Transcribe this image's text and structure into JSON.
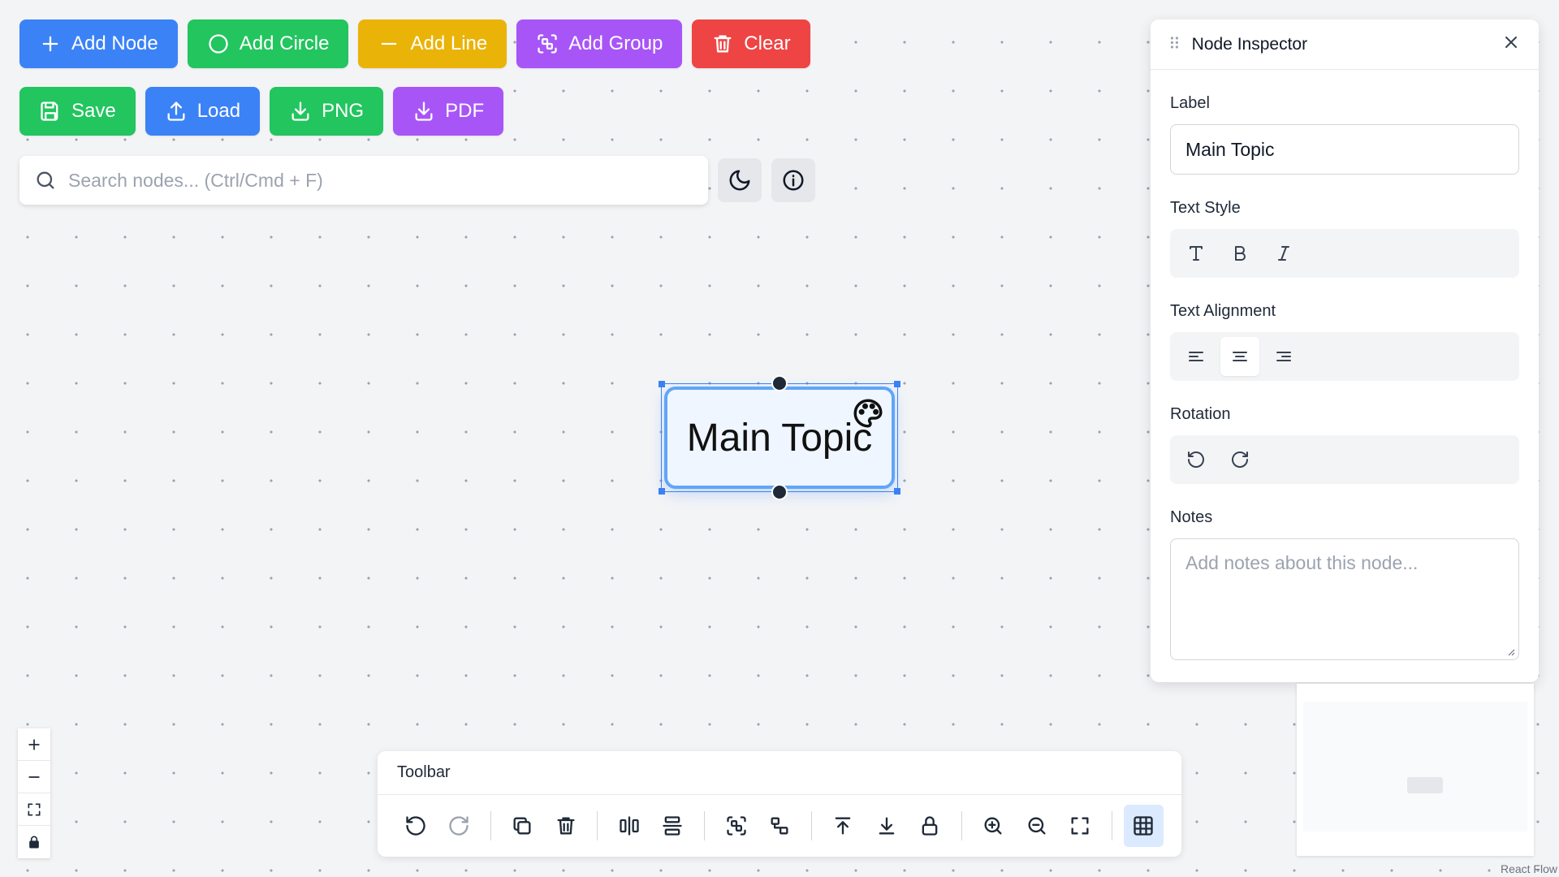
{
  "actions_row1": [
    {
      "label": "Add Node",
      "icon": "plus-icon",
      "color": "#3b82f6"
    },
    {
      "label": "Add Circle",
      "icon": "circle-icon",
      "color": "#22c55e"
    },
    {
      "label": "Add Line",
      "icon": "minus-icon",
      "color": "#eab308"
    },
    {
      "label": "Add Group",
      "icon": "group-icon",
      "color": "#a855f7"
    },
    {
      "label": "Clear",
      "icon": "trash-icon",
      "color": "#ef4444"
    }
  ],
  "actions_row2": [
    {
      "label": "Save",
      "icon": "save-icon",
      "color": "#22c55e"
    },
    {
      "label": "Load",
      "icon": "upload-icon",
      "color": "#3b82f6"
    },
    {
      "label": "PNG",
      "icon": "download-icon",
      "color": "#22c55e"
    },
    {
      "label": "PDF",
      "icon": "download-icon",
      "color": "#a855f7"
    }
  ],
  "search": {
    "placeholder": "Search nodes... (Ctrl/Cmd + F)",
    "value": ""
  },
  "node": {
    "label": "Main Topic",
    "selected": true
  },
  "inspector": {
    "title": "Node Inspector",
    "label_heading": "Label",
    "label_value": "Main Topic",
    "text_style_heading": "Text Style",
    "text_alignment_heading": "Text Alignment",
    "text_alignment_selected": "center",
    "rotation_heading": "Rotation",
    "notes_heading": "Notes",
    "notes_placeholder": "Add notes about this node..."
  },
  "toolbar": {
    "title": "Toolbar"
  },
  "attribution": "React Flow"
}
